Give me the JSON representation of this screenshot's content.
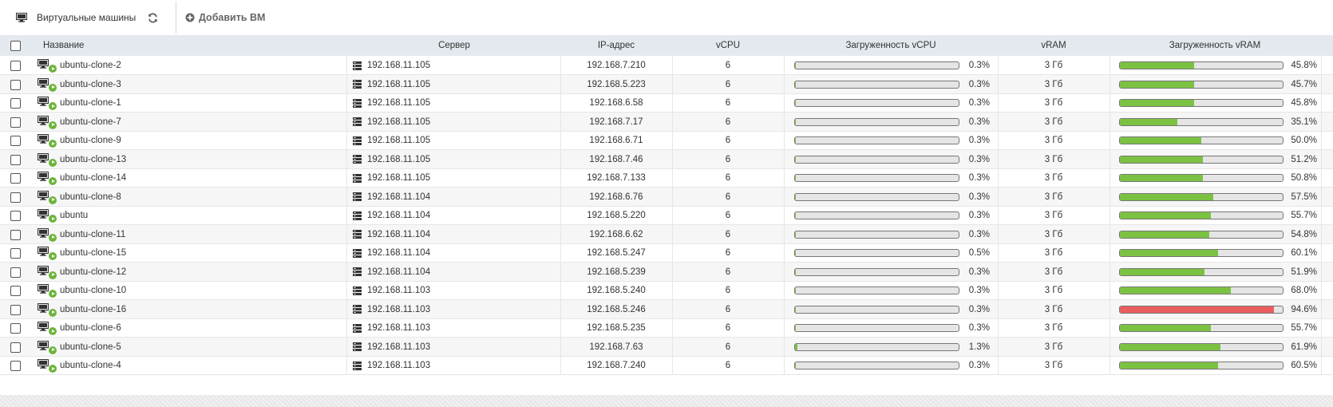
{
  "toolbar": {
    "title": "Виртуальные машины",
    "add_label": "Добавить ВМ"
  },
  "columns": {
    "name": "Название",
    "server": "Сервер",
    "ip": "IP-адрес",
    "vcpu": "vCPU",
    "vcpu_load": "Загруженность vCPU",
    "vram": "vRAM",
    "vram_load": "Загруженность vRAM"
  },
  "colors": {
    "header_bg": "#e3e9ee",
    "ok_bar": "#7cc242",
    "warn_bar": "#e95f5f",
    "running": "#6cb43a"
  },
  "rows": [
    {
      "name": "ubuntu-clone-2",
      "server": "192.168.11.105",
      "ip": "192.168.7.210",
      "vcpu": "6",
      "cpu_pct": "0.3%",
      "cpu": 0.3,
      "vram": "3 Гб",
      "ram_pct": "45.8%",
      "ram": 45.8
    },
    {
      "name": "ubuntu-clone-3",
      "server": "192.168.11.105",
      "ip": "192.168.5.223",
      "vcpu": "6",
      "cpu_pct": "0.3%",
      "cpu": 0.3,
      "vram": "3 Гб",
      "ram_pct": "45.7%",
      "ram": 45.7
    },
    {
      "name": "ubuntu-clone-1",
      "server": "192.168.11.105",
      "ip": "192.168.6.58",
      "vcpu": "6",
      "cpu_pct": "0.3%",
      "cpu": 0.3,
      "vram": "3 Гб",
      "ram_pct": "45.8%",
      "ram": 45.8
    },
    {
      "name": "ubuntu-clone-7",
      "server": "192.168.11.105",
      "ip": "192.168.7.17",
      "vcpu": "6",
      "cpu_pct": "0.3%",
      "cpu": 0.3,
      "vram": "3 Гб",
      "ram_pct": "35.1%",
      "ram": 35.1
    },
    {
      "name": "ubuntu-clone-9",
      "server": "192.168.11.105",
      "ip": "192.168.6.71",
      "vcpu": "6",
      "cpu_pct": "0.3%",
      "cpu": 0.3,
      "vram": "3 Гб",
      "ram_pct": "50.0%",
      "ram": 50.0
    },
    {
      "name": "ubuntu-clone-13",
      "server": "192.168.11.105",
      "ip": "192.168.7.46",
      "vcpu": "6",
      "cpu_pct": "0.3%",
      "cpu": 0.3,
      "vram": "3 Гб",
      "ram_pct": "51.2%",
      "ram": 51.2
    },
    {
      "name": "ubuntu-clone-14",
      "server": "192.168.11.105",
      "ip": "192.168.7.133",
      "vcpu": "6",
      "cpu_pct": "0.3%",
      "cpu": 0.3,
      "vram": "3 Гб",
      "ram_pct": "50.8%",
      "ram": 50.8
    },
    {
      "name": "ubuntu-clone-8",
      "server": "192.168.11.104",
      "ip": "192.168.6.76",
      "vcpu": "6",
      "cpu_pct": "0.3%",
      "cpu": 0.3,
      "vram": "3 Гб",
      "ram_pct": "57.5%",
      "ram": 57.5
    },
    {
      "name": "ubuntu",
      "server": "192.168.11.104",
      "ip": "192.168.5.220",
      "vcpu": "6",
      "cpu_pct": "0.3%",
      "cpu": 0.3,
      "vram": "3 Гб",
      "ram_pct": "55.7%",
      "ram": 55.7
    },
    {
      "name": "ubuntu-clone-11",
      "server": "192.168.11.104",
      "ip": "192.168.6.62",
      "vcpu": "6",
      "cpu_pct": "0.3%",
      "cpu": 0.3,
      "vram": "3 Гб",
      "ram_pct": "54.8%",
      "ram": 54.8
    },
    {
      "name": "ubuntu-clone-15",
      "server": "192.168.11.104",
      "ip": "192.168.5.247",
      "vcpu": "6",
      "cpu_pct": "0.5%",
      "cpu": 0.5,
      "vram": "3 Гб",
      "ram_pct": "60.1%",
      "ram": 60.1
    },
    {
      "name": "ubuntu-clone-12",
      "server": "192.168.11.104",
      "ip": "192.168.5.239",
      "vcpu": "6",
      "cpu_pct": "0.3%",
      "cpu": 0.3,
      "vram": "3 Гб",
      "ram_pct": "51.9%",
      "ram": 51.9
    },
    {
      "name": "ubuntu-clone-10",
      "server": "192.168.11.103",
      "ip": "192.168.5.240",
      "vcpu": "6",
      "cpu_pct": "0.3%",
      "cpu": 0.3,
      "vram": "3 Гб",
      "ram_pct": "68.0%",
      "ram": 68.0
    },
    {
      "name": "ubuntu-clone-16",
      "server": "192.168.11.103",
      "ip": "192.168.5.246",
      "vcpu": "6",
      "cpu_pct": "0.3%",
      "cpu": 0.3,
      "vram": "3 Гб",
      "ram_pct": "94.6%",
      "ram": 94.6
    },
    {
      "name": "ubuntu-clone-6",
      "server": "192.168.11.103",
      "ip": "192.168.5.235",
      "vcpu": "6",
      "cpu_pct": "0.3%",
      "cpu": 0.3,
      "vram": "3 Гб",
      "ram_pct": "55.7%",
      "ram": 55.7
    },
    {
      "name": "ubuntu-clone-5",
      "server": "192.168.11.103",
      "ip": "192.168.7.63",
      "vcpu": "6",
      "cpu_pct": "1.3%",
      "cpu": 1.3,
      "vram": "3 Гб",
      "ram_pct": "61.9%",
      "ram": 61.9
    },
    {
      "name": "ubuntu-clone-4",
      "server": "192.168.11.103",
      "ip": "192.168.7.240",
      "vcpu": "6",
      "cpu_pct": "0.3%",
      "cpu": 0.3,
      "vram": "3 Гб",
      "ram_pct": "60.5%",
      "ram": 60.5
    }
  ]
}
